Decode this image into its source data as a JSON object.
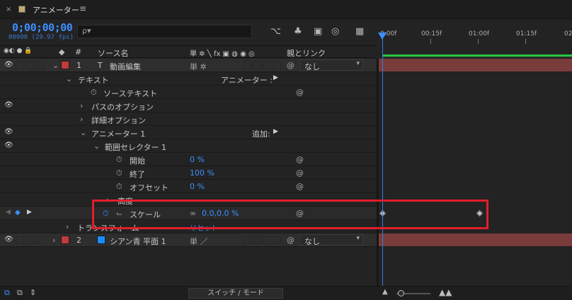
{
  "tab": {
    "close": "×",
    "title": "アニメーター",
    "menu": "≡",
    "swatch_color": "#c0a970"
  },
  "header": {
    "timecode": "0;00;00;00",
    "fps": "00000 (29.97 fps)",
    "search_icon": "ρ▾",
    "tools": [
      "⌥",
      "♣",
      "▣",
      "◎",
      "▦"
    ]
  },
  "ruler": {
    "ticks": [
      "0:00f",
      "00:15f",
      "01:00f",
      "01:15f",
      "02"
    ]
  },
  "columns": {
    "switch_icons": "◉◐ ● 🔒",
    "label_icon": "◆",
    "num": "#",
    "source_name": "ソース名",
    "switches": "単 ✲ ╲ fx ▣ ◍ ◉ ◎",
    "parent": "親とリンク"
  },
  "rows": [
    {
      "num": "1",
      "type_icon": "T",
      "name": "動画編集",
      "label_color": "#c23b3b",
      "parent": "なし",
      "switches": "単 ✲"
    },
    {
      "name": "テキスト",
      "right_label": "アニメーター :",
      "right_icon": "▶"
    },
    {
      "name": "ソーステキスト"
    },
    {
      "name": "パスのオプション"
    },
    {
      "name": "詳細オプション"
    },
    {
      "name": "アニメーター 1",
      "right_label": "追加:",
      "right_icon": "▶"
    },
    {
      "name": "範囲セレクター 1"
    },
    {
      "name": "開始",
      "value": "0 %"
    },
    {
      "name": "終了",
      "value": "100 %"
    },
    {
      "name": "オフセット",
      "value": "0 %"
    },
    {
      "name": "高度"
    },
    {
      "name": "スケール",
      "value": "0.0,0.0 %"
    },
    {
      "name": "トランスフォーム",
      "value": "リセット"
    },
    {
      "num": "2",
      "name": "シアン青 平面 1",
      "label_color": "#c23b3b",
      "layer_color": "#1a8cff",
      "parent": "なし",
      "switches": "単 ／"
    }
  ],
  "bottom": {
    "switch_mode": "スイッチ / モード"
  },
  "colors": {
    "timecode": "#3c8fff",
    "playhead": "#3c8fff",
    "annotation": "#e01e2a",
    "work_area": "#27c53f",
    "layer_bar": "#7a3b3b"
  }
}
